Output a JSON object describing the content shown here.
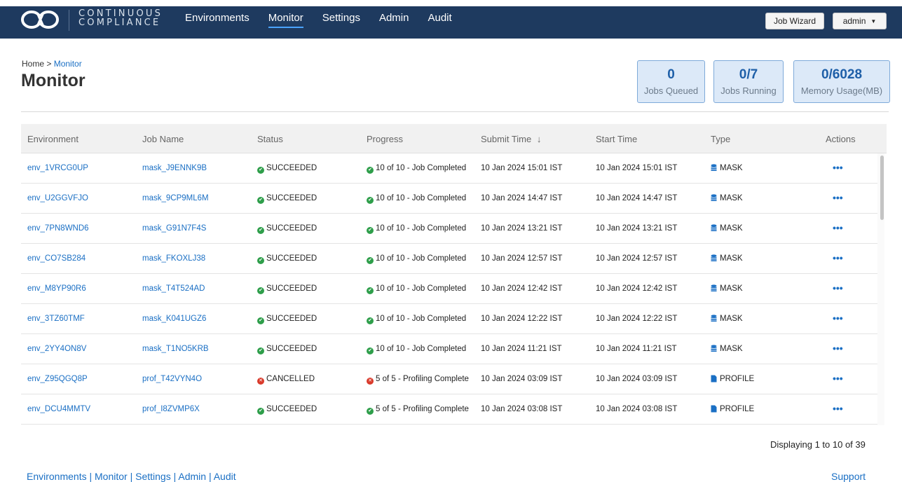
{
  "brand": {
    "line1": "CONTINUOUS",
    "line2": "COMPLIANCE"
  },
  "nav": [
    "Environments",
    "Monitor",
    "Settings",
    "Admin",
    "Audit"
  ],
  "nav_active": "Monitor",
  "header_buttons": {
    "job_wizard": "Job Wizard",
    "user": "admin"
  },
  "breadcrumb": {
    "home": "Home",
    "sep": " > ",
    "current": "Monitor"
  },
  "page_title": "Monitor",
  "stats": [
    {
      "value": "0",
      "label": "Jobs Queued"
    },
    {
      "value": "0/7",
      "label": "Jobs Running"
    },
    {
      "value": "0/6028",
      "label": "Memory Usage(MB)"
    }
  ],
  "table": {
    "columns": [
      "Environment",
      "Job Name",
      "Status",
      "Progress",
      "Submit Time",
      "Start Time",
      "Type",
      "Actions"
    ],
    "sort_indicator": "↓",
    "rows": [
      {
        "env": "env_1VRCG0UP",
        "job": "mask_J9ENNK9B",
        "status": "SUCCEEDED",
        "progress": "10 of 10 - Job Completed",
        "submit": "10 Jan 2024 15:01 IST",
        "start": "10 Jan 2024 15:01 IST",
        "type": "MASK"
      },
      {
        "env": "env_U2GGVFJO",
        "job": "mask_9CP9ML6M",
        "status": "SUCCEEDED",
        "progress": "10 of 10 - Job Completed",
        "submit": "10 Jan 2024 14:47 IST",
        "start": "10 Jan 2024 14:47 IST",
        "type": "MASK"
      },
      {
        "env": "env_7PN8WND6",
        "job": "mask_G91N7F4S",
        "status": "SUCCEEDED",
        "progress": "10 of 10 - Job Completed",
        "submit": "10 Jan 2024 13:21 IST",
        "start": "10 Jan 2024 13:21 IST",
        "type": "MASK"
      },
      {
        "env": "env_CO7SB284",
        "job": "mask_FKOXLJ38",
        "status": "SUCCEEDED",
        "progress": "10 of 10 - Job Completed",
        "submit": "10 Jan 2024 12:57 IST",
        "start": "10 Jan 2024 12:57 IST",
        "type": "MASK"
      },
      {
        "env": "env_M8YP90R6",
        "job": "mask_T4T524AD",
        "status": "SUCCEEDED",
        "progress": "10 of 10 - Job Completed",
        "submit": "10 Jan 2024 12:42 IST",
        "start": "10 Jan 2024 12:42 IST",
        "type": "MASK"
      },
      {
        "env": "env_3TZ60TMF",
        "job": "mask_K041UGZ6",
        "status": "SUCCEEDED",
        "progress": "10 of 10 - Job Completed",
        "submit": "10 Jan 2024 12:22 IST",
        "start": "10 Jan 2024 12:22 IST",
        "type": "MASK"
      },
      {
        "env": "env_2YY4ON8V",
        "job": "mask_T1NO5KRB",
        "status": "SUCCEEDED",
        "progress": "10 of 10 - Job Completed",
        "submit": "10 Jan 2024 11:21 IST",
        "start": "10 Jan 2024 11:21 IST",
        "type": "MASK"
      },
      {
        "env": "env_Z95QGQ8P",
        "job": "prof_T42VYN4O",
        "status": "CANCELLED",
        "progress": "5 of 5 - Profiling Complete",
        "submit": "10 Jan 2024 03:09 IST",
        "start": "10 Jan 2024 03:09 IST",
        "type": "PROFILE"
      },
      {
        "env": "env_DCU4MMTV",
        "job": "prof_I8ZVMP6X",
        "status": "SUCCEEDED",
        "progress": "5 of 5 - Profiling Complete",
        "submit": "10 Jan 2024 03:08 IST",
        "start": "10 Jan 2024 03:08 IST",
        "type": "PROFILE"
      }
    ],
    "actions_label": "•••"
  },
  "pager": "Displaying 1 to 10 of 39",
  "footer": {
    "links": [
      "Environments",
      "Monitor",
      "Settings",
      "Admin",
      "Audit"
    ],
    "sep": " | ",
    "support": "Support"
  },
  "colors": {
    "nav_bg": "#1e3a5f",
    "link": "#1a6fc4",
    "success": "#2e9e4a",
    "error": "#d93a2b",
    "stat_bg": "#dce9f8"
  }
}
